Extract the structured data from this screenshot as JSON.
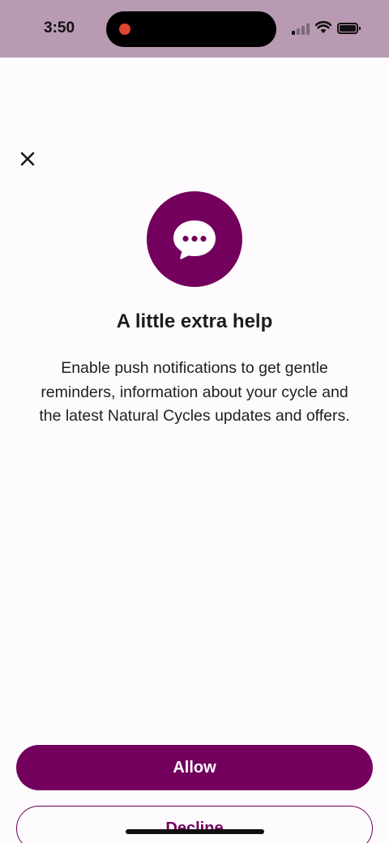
{
  "status_bar": {
    "time": "3:50",
    "recording_icon": "red-dot",
    "signal_icon": "cellular-signal",
    "wifi_icon": "wifi",
    "battery_icon": "battery-full"
  },
  "header": {
    "close_icon": "close-x"
  },
  "hero": {
    "icon": "chat-bubble-ellipsis",
    "color": "#73005c"
  },
  "content": {
    "title": "A little extra help",
    "body": "Enable push notifications to get gentle reminders, information about your cycle and the latest Natural Cycles updates and offers."
  },
  "actions": {
    "allow_label": "Allow",
    "decline_label": "Decline"
  },
  "colors": {
    "accent": "#73005c",
    "status_bar_bg": "#b89ab2",
    "background": "#fefbfe"
  }
}
